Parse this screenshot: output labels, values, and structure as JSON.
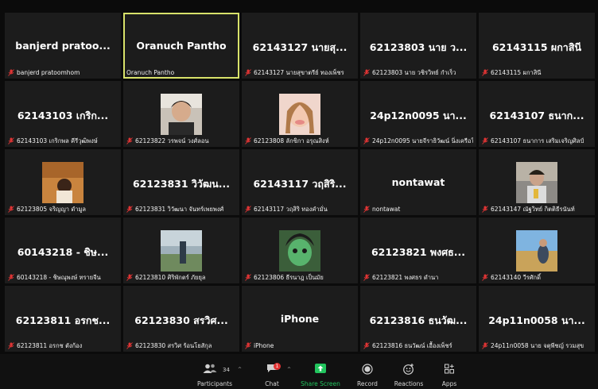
{
  "tiles": [
    {
      "big": "banjerd pratoo...",
      "label": "banjerd pratoomhom"
    },
    {
      "big": "Oranuch Pantho",
      "label": "Oranuch Pantho"
    },
    {
      "big": "62143127 นายสุ...",
      "label": "62143127 นายสุขาตรีย์ ทองเพ็ชร"
    },
    {
      "big": "62123803 นาย ว...",
      "label": "62123803 นาย วชิรวิทย์ กำเร็ว"
    },
    {
      "big": "62143115 ผกาสินี",
      "label": "62143115 ผกาสินี"
    },
    {
      "big": "62143103 เกริก...",
      "label": "62143103 เกริกพล คีรีวุฒิพงษ์"
    },
    {
      "label": "62123822 วรพจน์ วงศ์ลอน"
    },
    {
      "label": "62123808 ลักขิกา อรุณสิงห์"
    },
    {
      "big": "24p12n0095 นา...",
      "label": "24p12n0095 นายจีราธิวัฒน์ นิ่งเครือใจ"
    },
    {
      "big": "62143107 ธนาก...",
      "label": "62143107 ธนาการ เสริมเจริญศิลป์"
    },
    {
      "label": "62123805 จริญญา ดำมูล"
    },
    {
      "big": "62123831 วิวัฒน...",
      "label": "62123831 วิวัฒนา จันทร์เพยพงศ์"
    },
    {
      "big": "62143117 วฤสิริ...",
      "label": "62143117 วฤสิริ ทองคำมั่น"
    },
    {
      "big": "nontawat",
      "label": "nontawat"
    },
    {
      "label": "62143147 ณัฐวิทย์ กิตติธีรนันท์"
    },
    {
      "big": "60143218 - ชิษ...",
      "label": "60143218 - ชิษณุพงษ์ ทรายจีน"
    },
    {
      "label": "62123810 ศิริพักตร์ ภัยยุล"
    },
    {
      "label": "62123806 ธีรนาฎ เป็นมัย"
    },
    {
      "big": "62123821 พงศธ...",
      "label": "62123821 พงศธร ดำนา"
    },
    {
      "label": "62143140 วีรศักดิ์"
    },
    {
      "big": "62123811 อรกช...",
      "label": "62123811 อรกช ตังก้อง"
    },
    {
      "big": "62123830 สรวิศ...",
      "label": "62123830 สรวิศ ร้อนโยสักุล"
    },
    {
      "big": "iPhone",
      "label": "iPhone"
    },
    {
      "big": "62123816 ธนวัฒ...",
      "label": "62123816 ธนวัฒน์ เอื้องเพ็ชร์"
    },
    {
      "big": "24p11n0058 นา...",
      "label": "24p11n0058 นาย จตุพีชญ์ รวมสุข"
    }
  ],
  "toolbar": {
    "participants_label": "Participants",
    "participants_count": "34",
    "chat_label": "Chat",
    "chat_badge": "1",
    "share_label": "Share Screen",
    "record_label": "Record",
    "reactions_label": "Reactions",
    "apps_label": "Apps"
  },
  "colors": {
    "active_speaker": "#d8e26a",
    "share_green": "#22c55e",
    "mic_muted": "#e03434"
  }
}
